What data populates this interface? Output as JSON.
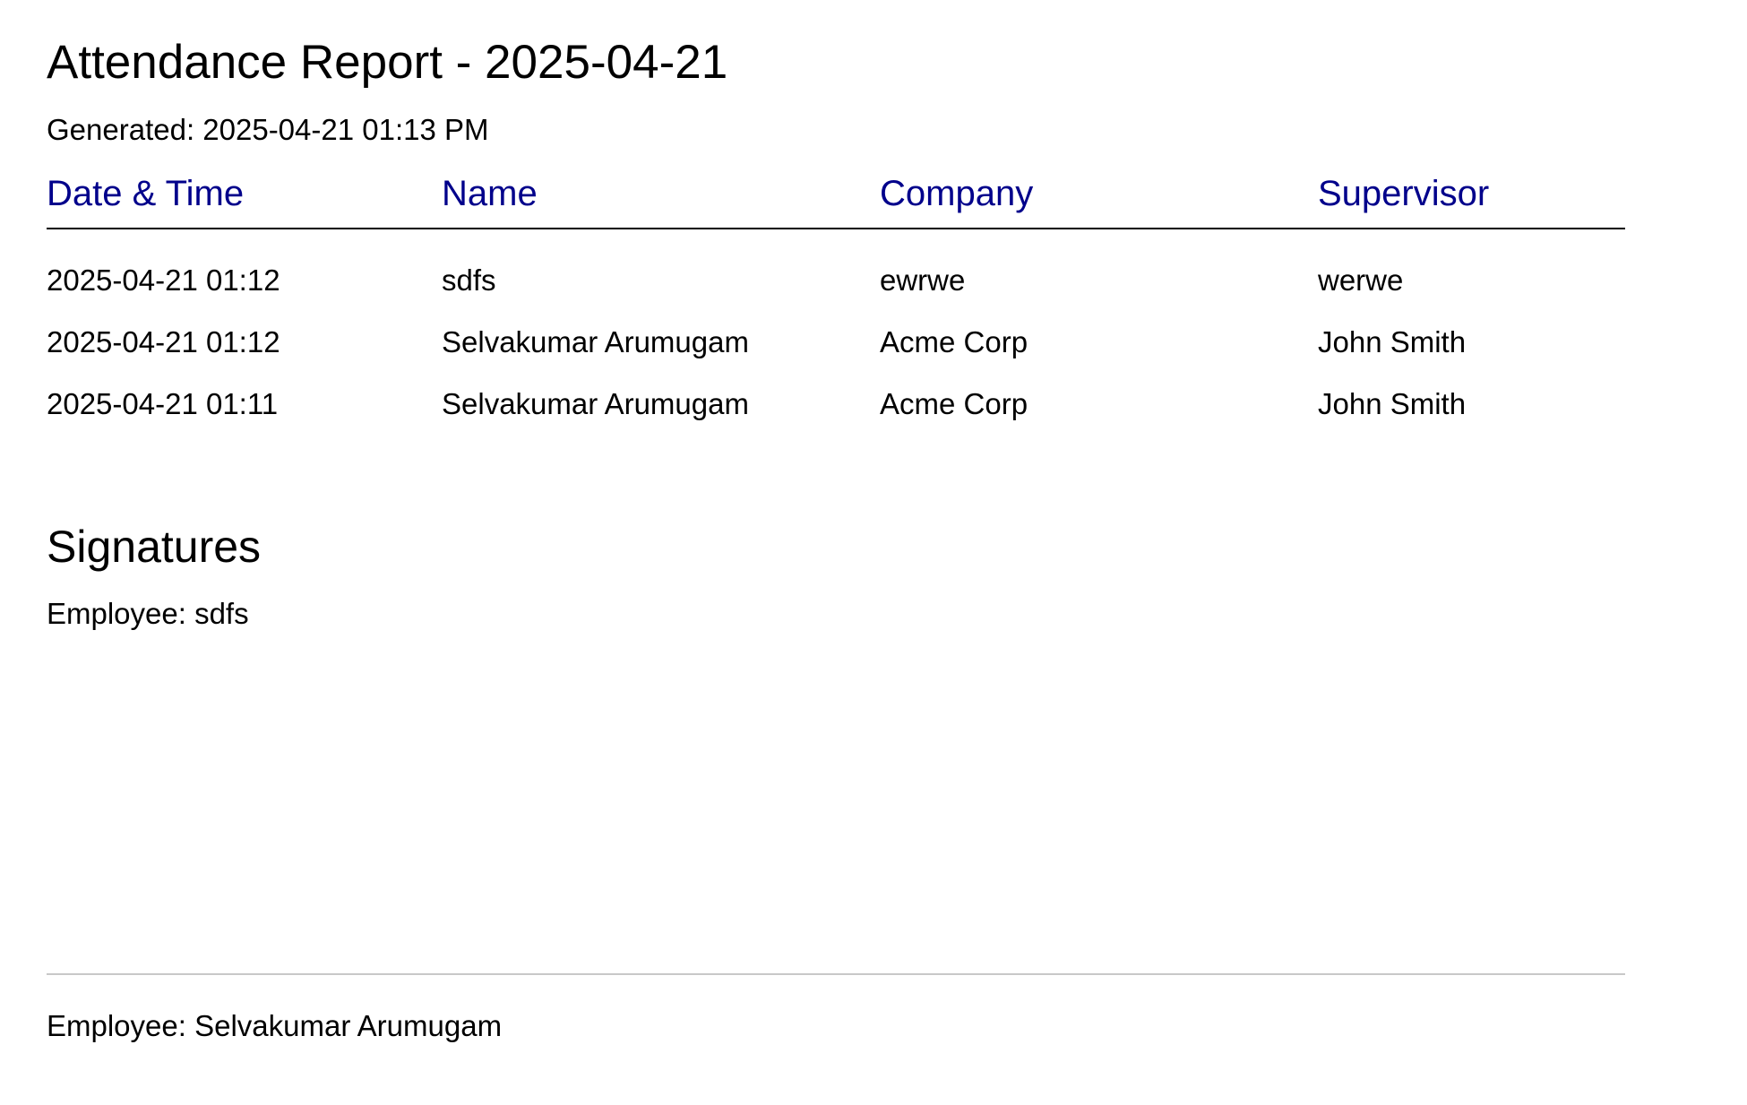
{
  "report": {
    "title": "Attendance Report - 2025-04-21",
    "generated": "Generated: 2025-04-21 01:13 PM"
  },
  "table": {
    "headers": [
      "Date & Time",
      "Name",
      "Company",
      "Supervisor"
    ],
    "header_color": "#00008b",
    "rows": [
      [
        "2025-04-21 01:12",
        "sdfs",
        "ewrwe",
        "werwe"
      ],
      [
        "2025-04-21 01:12",
        "Selvakumar Arumugam",
        "Acme Corp",
        "John Smith"
      ],
      [
        "2025-04-21 01:11",
        "Selvakumar Arumugam",
        "Acme Corp",
        "John Smith"
      ]
    ]
  },
  "signatures": {
    "heading": "Signatures",
    "entries": [
      {
        "label": "Employee: sdfs",
        "has_signature_image": true
      },
      {
        "label": "Employee: Selvakumar Arumugam",
        "has_signature_image": false
      }
    ]
  }
}
